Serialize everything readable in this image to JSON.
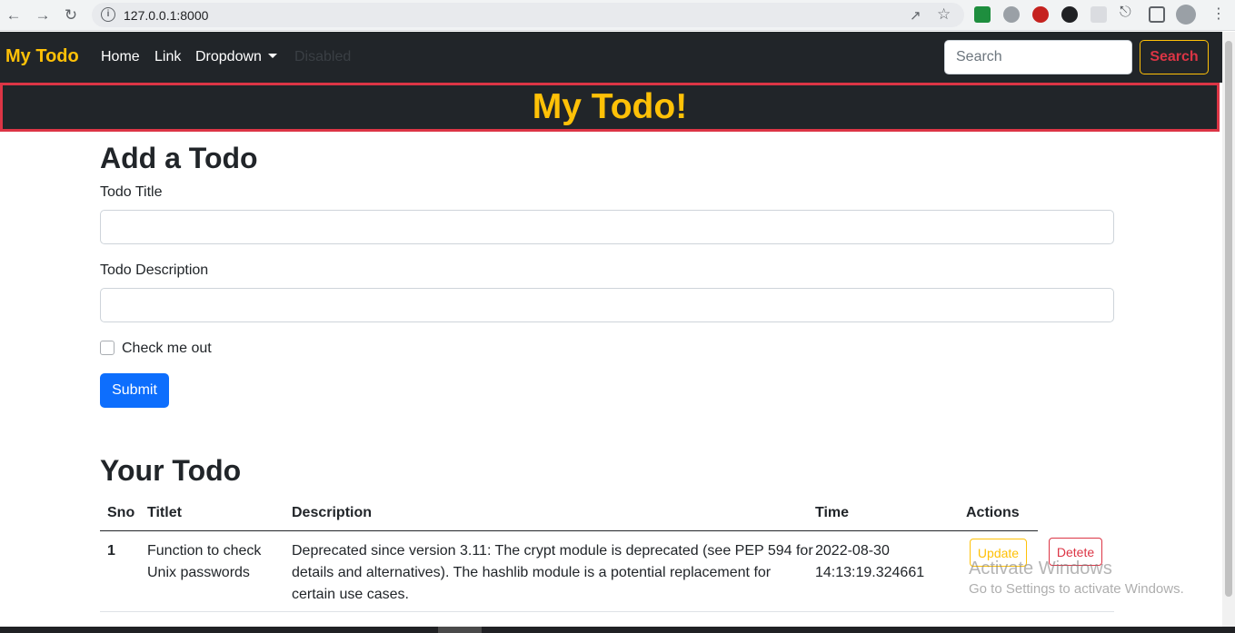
{
  "browser": {
    "url": "127.0.0.1:8000",
    "back_icon": "arrow-left-icon",
    "forward_icon": "arrow-right-icon",
    "reload_icon": "reload-icon"
  },
  "navbar": {
    "brand": "My Todo",
    "links": [
      "Home",
      "Link",
      "Dropdown",
      "Disabled"
    ],
    "search_placeholder": "Search",
    "search_button": "Search"
  },
  "hero": {
    "title": "My Todo!"
  },
  "form": {
    "heading": "Add a Todo",
    "title_label": "Todo Title",
    "title_value": "",
    "desc_label": "Todo Description",
    "desc_value": "",
    "checkbox_label": "Check me out",
    "checkbox_checked": false,
    "submit_label": "Submit"
  },
  "todos": {
    "heading": "Your Todo",
    "columns": [
      "Sno",
      "Titlet",
      "Description",
      "Time",
      "Actions"
    ],
    "rows": [
      {
        "sno": "1",
        "title_line1": "Function to check",
        "title_line2": "Unix passwords",
        "desc_line1": "Deprecated since version 3.11: The crypt module is deprecated (see PEP 594 for",
        "desc_line2": "details and alternatives). The hashlib module is a potential replacement for",
        "desc_line3": "certain use cases.",
        "time_line1": "2022-08-30",
        "time_line2": "14:13:19.324661",
        "update_label": "Update",
        "delete_label": "Detete"
      }
    ]
  },
  "watermark": {
    "line1": "Activate Windows",
    "line2": "Go to Settings to activate Windows."
  },
  "colors": {
    "dark": "#212529",
    "warning": "#ffc107",
    "danger": "#dc3545",
    "primary": "#0d6efd"
  }
}
